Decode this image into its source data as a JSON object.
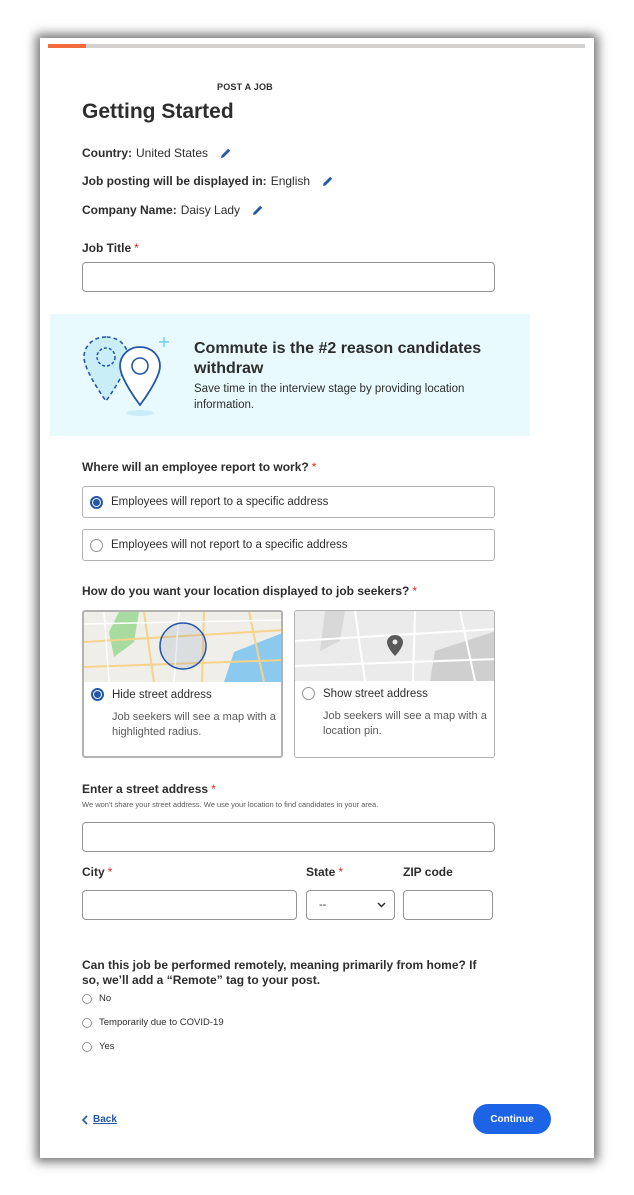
{
  "header": {
    "eyebrow": "POST A JOB",
    "title": "Getting Started"
  },
  "details": {
    "country_label": "Country:",
    "country_value": "United States",
    "language_label": "Job posting will be displayed in:",
    "language_value": "English",
    "company_label": "Company Name:",
    "company_value": "Daisy Lady"
  },
  "job_title": {
    "label": "Job Title",
    "required": "*",
    "value": "",
    "placeholder": ""
  },
  "banner": {
    "title": "Commute is the #2 reason candidates withdraw",
    "text": "Save time in the interview stage by providing location information."
  },
  "report_to_work": {
    "label": "Where will an employee report to work?",
    "required": "*",
    "options": [
      "Employees will report to a specific address",
      "Employees will not report to a specific address"
    ],
    "selected": 0
  },
  "location_display": {
    "label": "How do you want your location displayed to job seekers?",
    "required": "*",
    "options": [
      {
        "label": "Hide street address",
        "desc": "Job seekers will see a map with a highlighted radius.",
        "selected": true
      },
      {
        "label": "Show street address",
        "desc": "Job seekers will see a map with a location pin.",
        "selected": false
      }
    ]
  },
  "street": {
    "label": "Enter a street address",
    "required": "*",
    "note": "We won't share your street address. We use your location to find candidates in your area.",
    "value": ""
  },
  "city": {
    "label": "City",
    "required": "*",
    "value": ""
  },
  "state": {
    "label": "State",
    "required": "*",
    "selected": "--"
  },
  "zip": {
    "label": "ZIP code",
    "value": ""
  },
  "remote": {
    "question": "Can this job be performed remotely, meaning primarily from home? If so, we’ll add a “Remote” tag to your post.",
    "options": [
      "No",
      "Temporarily due to COVID-19",
      "Yes"
    ]
  },
  "footer": {
    "back_label": "Back",
    "continue_label": "Continue"
  },
  "colors": {
    "accent": "#2557a7",
    "button": "#1d63e6",
    "progress": "#f26b3a",
    "banner_bg": "#e8fafd",
    "required": "#d8291d"
  },
  "progress": {
    "fraction": 0.07
  }
}
